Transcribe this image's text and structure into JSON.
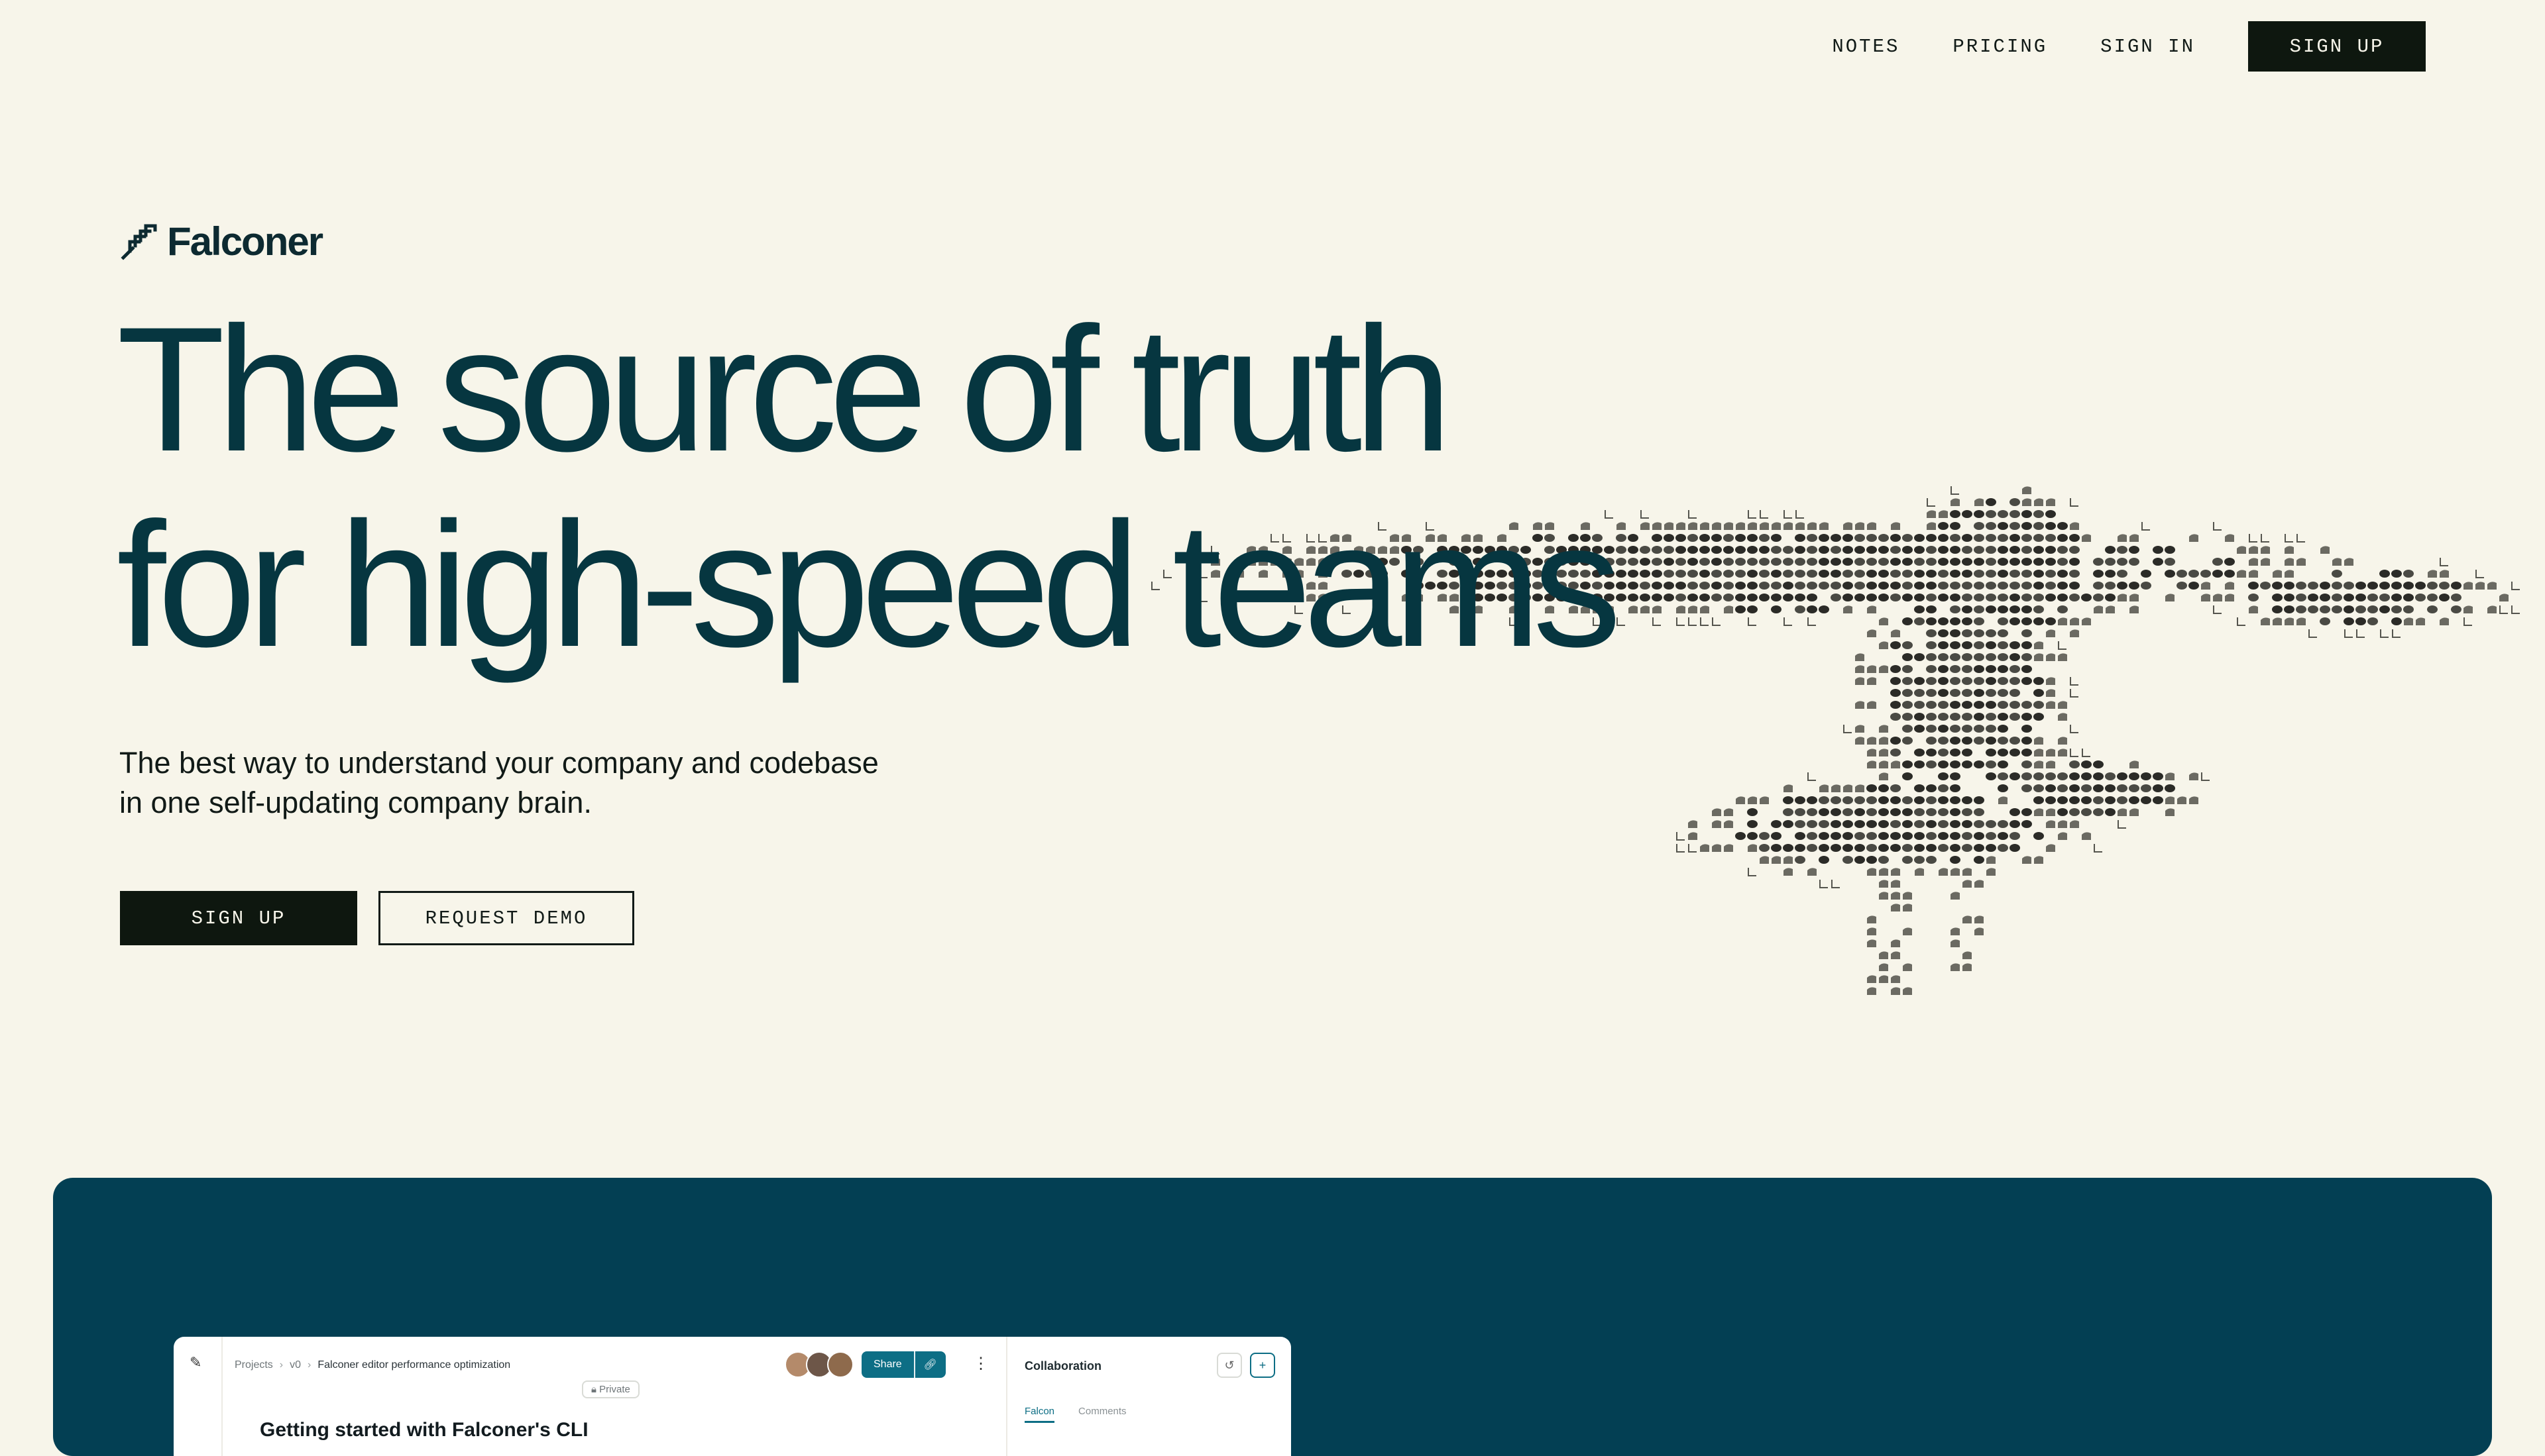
{
  "nav": {
    "links": [
      "NOTES",
      "PRICING",
      "SIGN IN"
    ],
    "signup": "SIGN UP"
  },
  "logo": {
    "word": "Falconer",
    "icon": "falcon-feather-icon"
  },
  "hero": {
    "headline_line1": "The source of truth",
    "headline_line2": "for high-speed teams",
    "subtitle_line1": "The best way to understand your company and codebase",
    "subtitle_line2": "in one self-updating company brain.",
    "primary_cta": "SIGN UP",
    "secondary_cta": "REQUEST DEMO"
  },
  "app_preview": {
    "breadcrumbs": [
      "Projects",
      "v0",
      "Falconer editor performance optimization"
    ],
    "private_badge": "Private",
    "share_label": "Share",
    "doc_title": "Getting started with Falconer's CLI",
    "panel": {
      "title": "Collaboration",
      "tabs": [
        "Falcon",
        "Comments"
      ],
      "active_tab": "Falcon"
    }
  },
  "colors": {
    "background": "#f7f5ea",
    "headline": "#063640",
    "ink": "#0e170f",
    "dark_panel": "#033f53",
    "accent": "#0d6e85"
  }
}
